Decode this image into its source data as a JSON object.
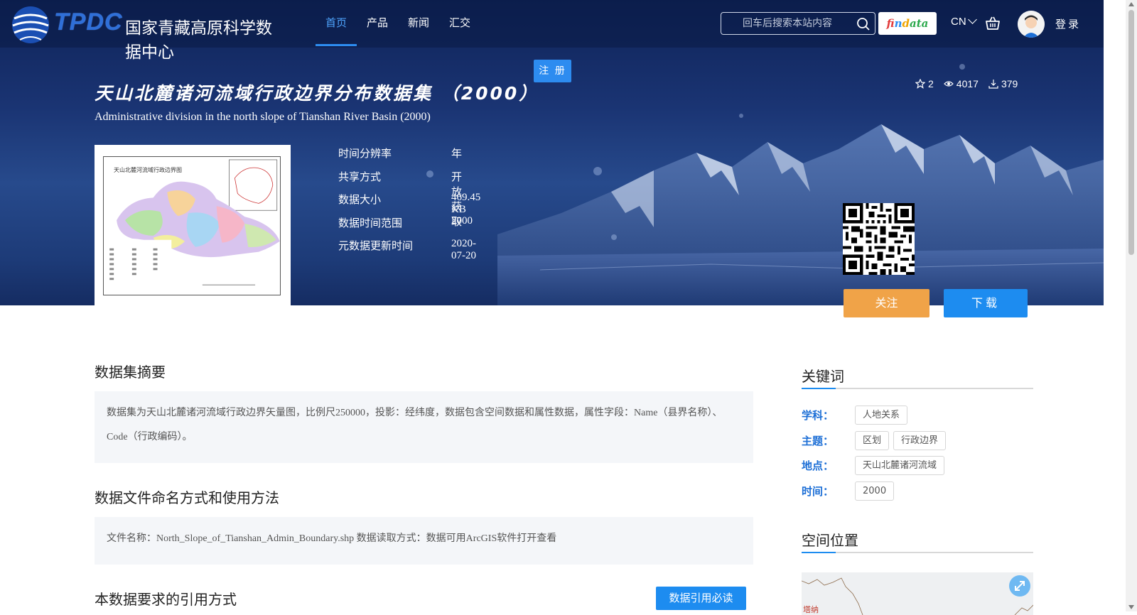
{
  "header": {
    "logo_text": "TPDC",
    "logo_cn": "国家青藏高原科学数据中心",
    "nav": [
      {
        "label": "首页",
        "active": true
      },
      {
        "label": "产品",
        "active": false
      },
      {
        "label": "新闻",
        "active": false
      },
      {
        "label": "汇交",
        "active": false
      }
    ],
    "search_placeholder": "回车后搜索本站内容",
    "findata": {
      "p1": "fi",
      "p2": "n",
      "p3": "d",
      "p4": "ata"
    },
    "lang": "CN",
    "login": "登录",
    "register": "注 册"
  },
  "dataset": {
    "title_cn": "天山北麓诸河流域行政边界分布数据集 （2000）",
    "title_en": "Administrative division in the north slope of Tianshan River Basin (2000)",
    "stats": {
      "stars": "2",
      "views": "4017",
      "downloads": "379"
    },
    "thumbnail_title": "天山北麓河流域行政边界图",
    "meta": [
      {
        "key": "时间分辨率",
        "value": "年"
      },
      {
        "key": "共享方式",
        "value": "开放获取"
      },
      {
        "key": "数据大小",
        "value": "469.45 KB"
      },
      {
        "key": "数据时间范围",
        "value": "2000"
      },
      {
        "key": "元数据更新时间",
        "value": "2020-07-20"
      }
    ],
    "follow_label": "关注",
    "download_label": "下载"
  },
  "content": {
    "abstract_title": "数据集摘要",
    "abstract_text": "数据集为天山北麓诸河流域行政边界矢量图，比例尺250000，投影：经纬度，数据包含空间数据和属性数据，属性字段：Name（县界名称）、Code（行政编码）。",
    "naming_title": "数据文件命名方式和使用方法",
    "naming_text": "文件名称：North_Slope_of_Tianshan_Admin_Boundary.shp 数据读取方式：数据可用ArcGIS软件打开查看",
    "citation_title": "本数据要求的引用方式",
    "citation_button": "数据引用必读"
  },
  "sidebar": {
    "keywords_title": "关键词",
    "keywords": [
      {
        "label": "学科：",
        "tags": [
          "人地关系"
        ]
      },
      {
        "label": "主题：",
        "tags": [
          "区划",
          "行政边界"
        ]
      },
      {
        "label": "地点：",
        "tags": [
          "天山北麓诸河流域"
        ]
      },
      {
        "label": "时间：",
        "tags": [
          "2000"
        ]
      }
    ],
    "location_title": "空间位置",
    "map_label": "塔纳"
  },
  "colors": {
    "accent": "#1d8cf0",
    "follow": "#f0a348",
    "nav_active": "#4fa6ff"
  }
}
